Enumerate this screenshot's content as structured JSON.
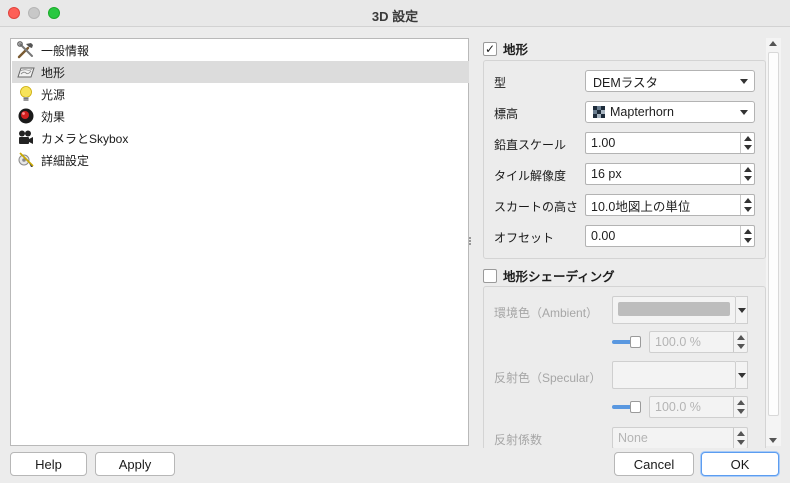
{
  "window": {
    "title": "3D 設定"
  },
  "sidebar": {
    "items": [
      {
        "label": "一般情報",
        "icon": "hammer-wrench-icon"
      },
      {
        "label": "地形",
        "icon": "terrain-map-icon",
        "selected": true
      },
      {
        "label": "光源",
        "icon": "light-bulb-icon"
      },
      {
        "label": "効果",
        "icon": "effects-sphere-icon"
      },
      {
        "label": "カメラとSkybox",
        "icon": "camera-icon"
      },
      {
        "label": "詳細設定",
        "icon": "advanced-settings-icon"
      }
    ]
  },
  "terrain": {
    "group_title": "地形",
    "checked": true,
    "type": {
      "label": "型",
      "value": "DEMラスタ"
    },
    "elevation": {
      "label": "標高",
      "value": "Mapterhorn",
      "icon": "raster-layer-icon"
    },
    "vertical_scale": {
      "label": "鉛直スケール",
      "value": "1.00"
    },
    "tile_resolution": {
      "label": "タイル解像度",
      "value": "16 px"
    },
    "skirt_height": {
      "label": "スカートの高さ",
      "value": "10.0地図上の単位"
    },
    "offset": {
      "label": "オフセット",
      "value": "0.00"
    }
  },
  "shading": {
    "group_title": "地形シェーディング",
    "checked": false,
    "ambient": {
      "label": "環境色（Ambient）",
      "opacity": "100.0 %",
      "swatch_color": "#bdbdbd"
    },
    "specular": {
      "label": "反射色（Specular）",
      "opacity": "100.0 %"
    },
    "shininess": {
      "label": "反射係数",
      "placeholder": "None"
    }
  },
  "buttons": {
    "help": "Help",
    "apply": "Apply",
    "cancel": "Cancel",
    "ok": "OK"
  },
  "colors": {
    "accent": "#5c9df0",
    "selection": "#dcdcdc"
  }
}
